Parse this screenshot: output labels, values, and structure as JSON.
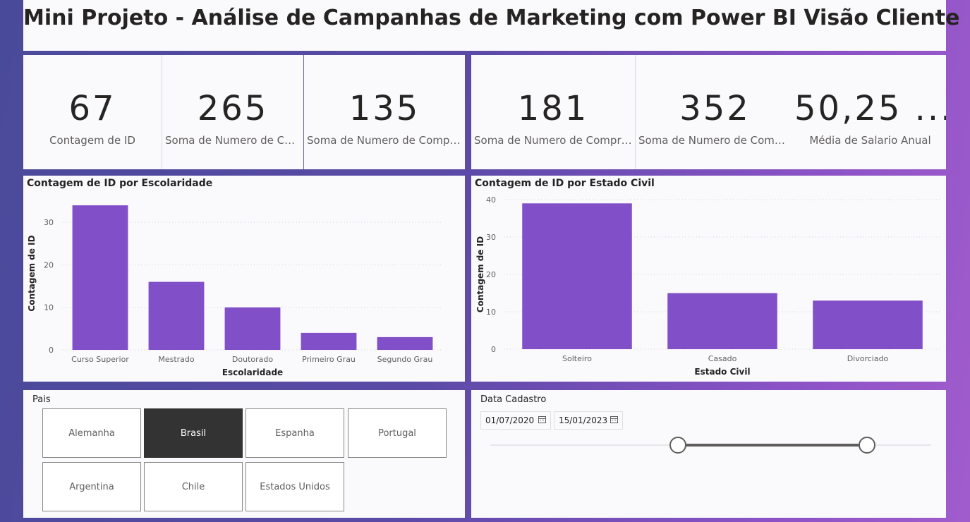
{
  "header": {
    "title": "Mini Projeto - Análise de Campanhas de Marketing com Power BI Visão Cliente"
  },
  "kpis": [
    {
      "value": "67",
      "label": "Contagem de ID"
    },
    {
      "value": "265",
      "label": "Soma de Numero de Compras"
    },
    {
      "value": "135",
      "label": "Soma de Numero de Compras"
    },
    {
      "value": "181",
      "label": "Soma de Numero de Compras"
    },
    {
      "value": "352",
      "label": "Soma de Numero de Compras"
    },
    {
      "value": "50,25 ...",
      "label": "Média de Salario Anual"
    }
  ],
  "chart_data": [
    {
      "type": "bar",
      "title": "Contagem de ID por Escolaridade",
      "xlabel": "Escolaridade",
      "ylabel": "Contagem de ID",
      "categories": [
        "Curso Superior",
        "Mestrado",
        "Doutorado",
        "Primeiro Grau",
        "Segundo Grau"
      ],
      "values": [
        34,
        16,
        10,
        4,
        3
      ],
      "ylim": [
        0,
        36
      ],
      "yticks": [
        0,
        10,
        20,
        30
      ],
      "grid": true,
      "color": "#8150c8"
    },
    {
      "type": "bar",
      "title": "Contagem de ID por Estado Civil",
      "xlabel": "Estado Civil",
      "ylabel": "Contagem de ID",
      "categories": [
        "Solteiro",
        "Casado",
        "Divorciado"
      ],
      "values": [
        39,
        15,
        13
      ],
      "ylim": [
        0,
        40
      ],
      "yticks": [
        0,
        10,
        20,
        30,
        40
      ],
      "grid": true,
      "color": "#8150c8"
    }
  ],
  "slicer_pais": {
    "title": "Pais",
    "options": [
      "Alemanha",
      "Brasil",
      "Espanha",
      "Portugal",
      "Argentina",
      "Chile",
      "Estados Unidos"
    ],
    "selected": "Brasil"
  },
  "slicer_data": {
    "title": "Data Cadastro",
    "start": "01/07/2020",
    "end": "15/01/2023",
    "calendar_icon": "calendar-icon",
    "range_fraction": [
      0.425,
      0.855
    ]
  },
  "colors": {
    "bar": "#8150c8",
    "selected_tile": "#333333",
    "accent": "#8a52c6"
  }
}
